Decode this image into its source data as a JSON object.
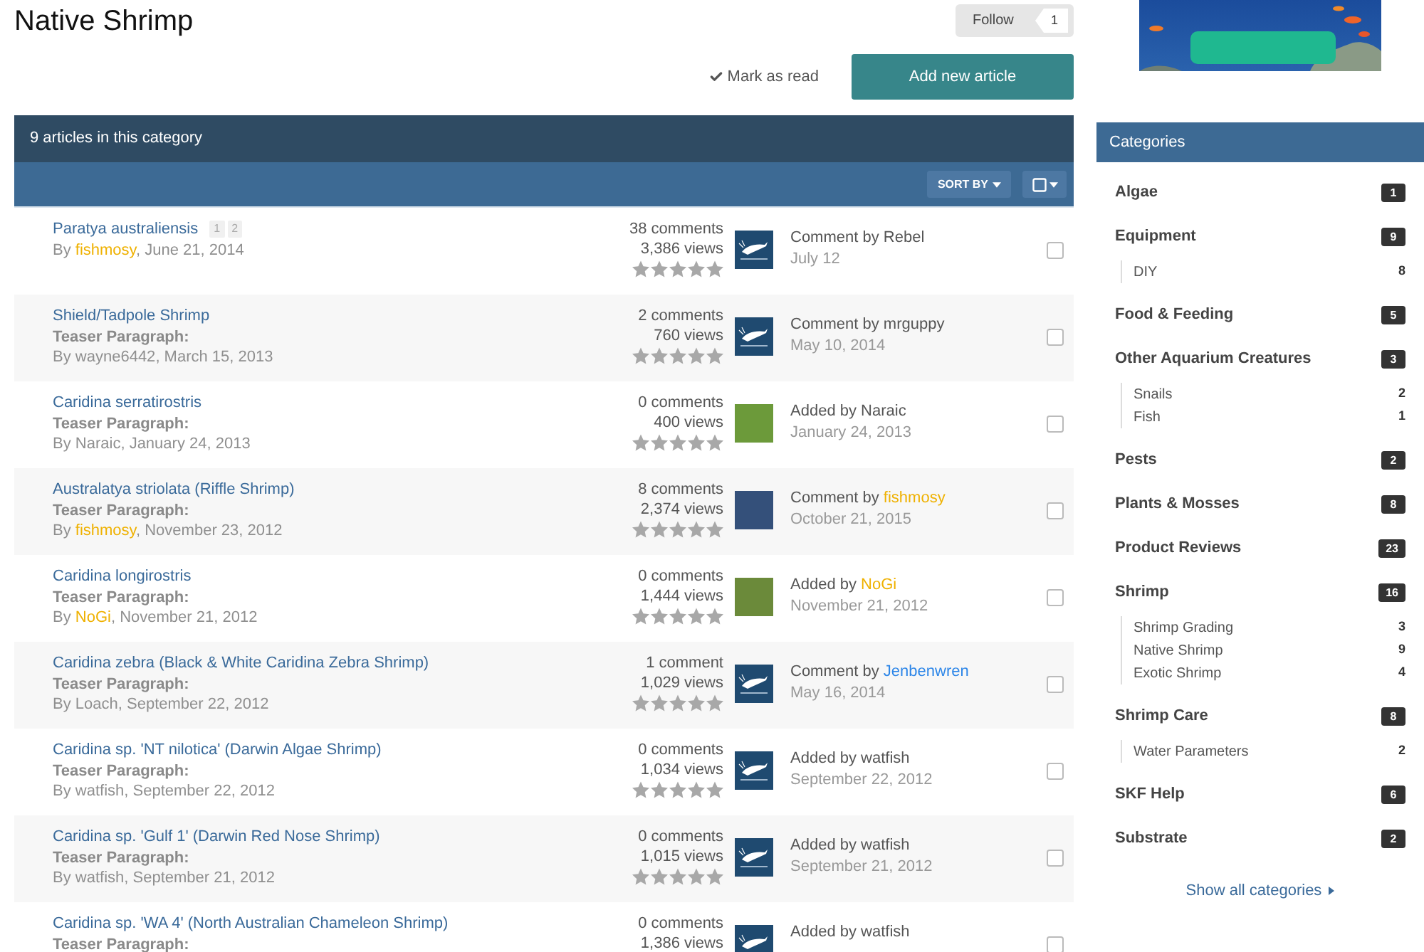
{
  "page": {
    "title": "Native Shrimp"
  },
  "follow": {
    "label": "Follow",
    "count": "1"
  },
  "actions": {
    "mark_read": "Mark as read",
    "add_article": "Add new article"
  },
  "list": {
    "header": "9 articles in this category",
    "sort_label": "SORT BY",
    "articles": [
      {
        "title": "Paratya australiensis",
        "page_links": [
          "1",
          "2"
        ],
        "byline": {
          "prefix": "By",
          "author": {
            "name": "fishmosy",
            "color": "#efb100"
          },
          "suffix": ", June 21, 2014"
        },
        "comments": "38 comments",
        "views": "3,386 views",
        "stars": 0,
        "thumbnail": {
          "kind": "logo"
        },
        "activity": {
          "label": "Comment by",
          "user": {
            "name": "Rebel"
          },
          "date": "July 12"
        },
        "checked": false
      },
      {
        "title": "Shield/Tadpole Shrimp",
        "teaser": "Teaser Paragraph:",
        "byline": {
          "prefix": "By",
          "author": {
            "name": "wayne6442"
          },
          "suffix": ", March 15, 2013"
        },
        "comments": "2 comments",
        "views": "760 views",
        "stars": 0,
        "thumbnail": {
          "kind": "logo"
        },
        "activity": {
          "label": "Comment by",
          "user": {
            "name": "mrguppy"
          },
          "date": "May 10, 2014"
        },
        "checked": false
      },
      {
        "title": "Caridina serratirostris",
        "teaser": "Teaser Paragraph:",
        "byline": {
          "prefix": "By",
          "author": {
            "name": "Naraic"
          },
          "suffix": ", January 24, 2013"
        },
        "comments": "0 comments",
        "views": "400 views",
        "stars": 0,
        "thumbnail": {
          "kind": "photo",
          "color": "#6c9a3a"
        },
        "activity": {
          "label": "Added by",
          "user": {
            "name": "Naraic"
          },
          "date": "January 24, 2013"
        },
        "checked": false
      },
      {
        "title": "Australatya striolata (Riffle Shrimp)",
        "teaser": "Teaser Paragraph:",
        "byline": {
          "prefix": "By",
          "author": {
            "name": "fishmosy",
            "color": "#efb100"
          },
          "suffix": ", November 23, 2012"
        },
        "comments": "8 comments",
        "views": "2,374 views",
        "stars": 0,
        "thumbnail": {
          "kind": "photo",
          "color": "#34507a"
        },
        "activity": {
          "label": "Comment by",
          "user": {
            "name": "fishmosy",
            "color": "#efb100"
          },
          "date": "October 21, 2015"
        },
        "checked": false
      },
      {
        "title": "Caridina longirostris",
        "teaser": "Teaser Paragraph:",
        "byline": {
          "prefix": "By",
          "author": {
            "name": "NoGi",
            "color": "#efb100"
          },
          "suffix": ", November 21, 2012"
        },
        "comments": "0 comments",
        "views": "1,444 views",
        "stars": 0,
        "thumbnail": {
          "kind": "photo",
          "color": "#6b8a3a"
        },
        "activity": {
          "label": "Added by",
          "user": {
            "name": "NoGi",
            "color": "#efb100"
          },
          "date": "November 21, 2012"
        },
        "checked": false
      },
      {
        "title": "Caridina zebra (Black & White Caridina Zebra Shrimp)",
        "teaser": "Teaser Paragraph:",
        "byline": {
          "prefix": "By",
          "author": {
            "name": "Loach"
          },
          "suffix": ", September 22, 2012"
        },
        "comments": "1 comment",
        "views": "1,029 views",
        "stars": 0,
        "thumbnail": {
          "kind": "logo"
        },
        "activity": {
          "label": "Comment by",
          "user": {
            "name": "Jenbenwren",
            "color": "#2d86e8"
          },
          "date": "May 16, 2014"
        },
        "checked": false
      },
      {
        "title": "Caridina sp. 'NT nilotica' (Darwin Algae Shrimp)",
        "teaser": "Teaser Paragraph:",
        "byline": {
          "prefix": "By",
          "author": {
            "name": "watfish"
          },
          "suffix": ", September 22, 2012"
        },
        "comments": "0 comments",
        "views": "1,034 views",
        "stars": 0,
        "thumbnail": {
          "kind": "logo"
        },
        "activity": {
          "label": "Added by",
          "user": {
            "name": "watfish"
          },
          "date": "September 22, 2012"
        },
        "checked": false
      },
      {
        "title": "Caridina sp. 'Gulf 1' (Darwin Red Nose Shrimp)",
        "teaser": "Teaser Paragraph:",
        "byline": {
          "prefix": "By",
          "author": {
            "name": "watfish"
          },
          "suffix": ", September 21, 2012"
        },
        "comments": "0 comments",
        "views": "1,015 views",
        "stars": 0,
        "thumbnail": {
          "kind": "logo"
        },
        "activity": {
          "label": "Added by",
          "user": {
            "name": "watfish"
          },
          "date": "September 21, 2012"
        },
        "checked": false
      },
      {
        "title": "Caridina sp. 'WA 4' (North Australian Chameleon Shrimp)",
        "teaser": "Teaser Paragraph:",
        "comments": "0 comments",
        "views": "1,386 views",
        "thumbnail": {
          "kind": "logo"
        },
        "activity": {
          "label": "Added by",
          "user": {
            "name": "watfish"
          }
        },
        "checked": false
      }
    ]
  },
  "sidebar": {
    "title": "Categories",
    "categories": [
      {
        "name": "Algae",
        "count": "1"
      },
      {
        "name": "Equipment",
        "count": "9",
        "children": [
          {
            "name": "DIY",
            "count": "8"
          }
        ]
      },
      {
        "name": "Food & Feeding",
        "count": "5"
      },
      {
        "name": "Other Aquarium Creatures",
        "count": "3",
        "children": [
          {
            "name": "Snails",
            "count": "2"
          },
          {
            "name": "Fish",
            "count": "1"
          }
        ]
      },
      {
        "name": "Pests",
        "count": "2"
      },
      {
        "name": "Plants & Mosses",
        "count": "8"
      },
      {
        "name": "Product Reviews",
        "count": "23"
      },
      {
        "name": "Shrimp",
        "count": "16",
        "children": [
          {
            "name": "Shrimp Grading",
            "count": "3"
          },
          {
            "name": "Native Shrimp",
            "count": "9"
          },
          {
            "name": "Exotic Shrimp",
            "count": "4"
          }
        ]
      },
      {
        "name": "Shrimp Care",
        "count": "8",
        "children": [
          {
            "name": "Water Parameters",
            "count": "2"
          }
        ]
      },
      {
        "name": "SKF Help",
        "count": "6"
      },
      {
        "name": "Substrate",
        "count": "2"
      }
    ],
    "show_all": "Show all categories"
  }
}
